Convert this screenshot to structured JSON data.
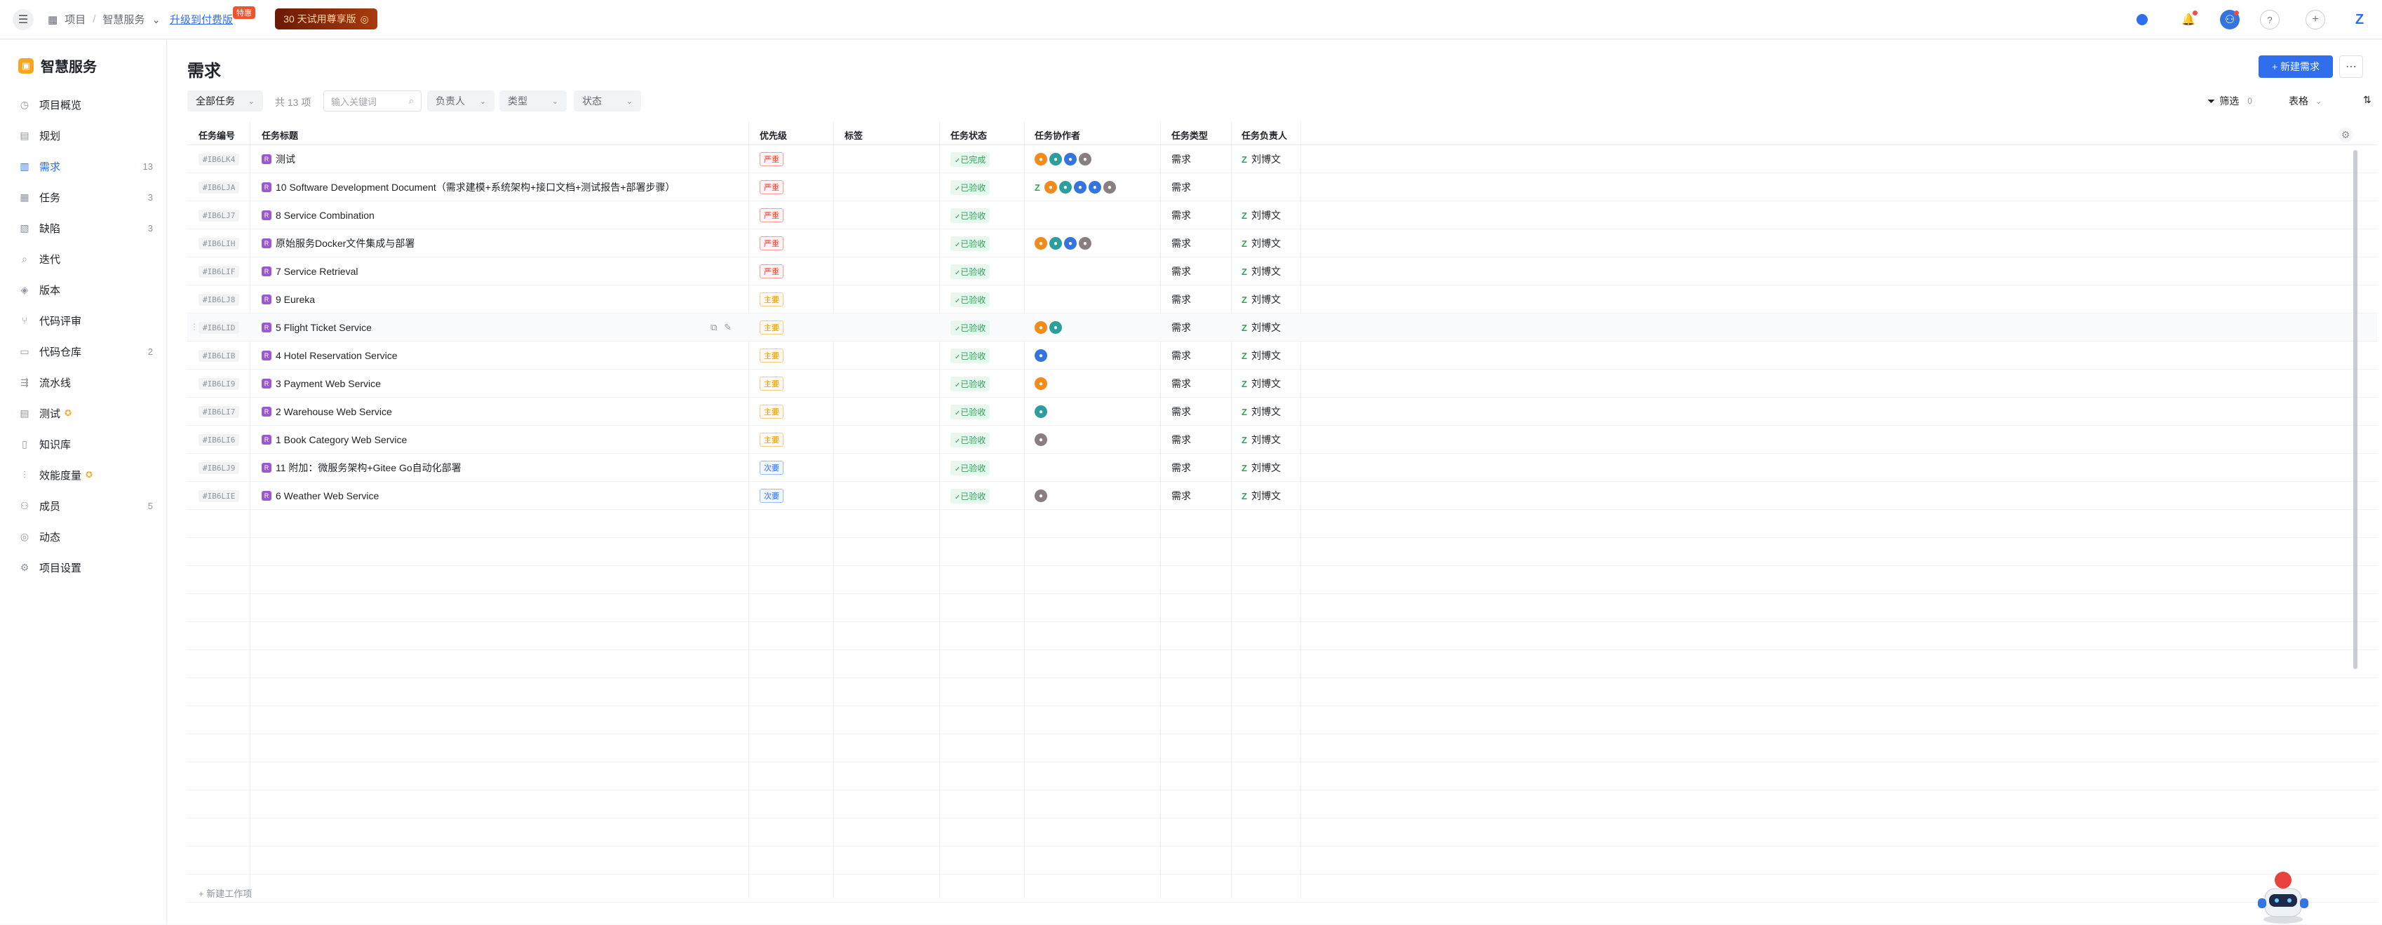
{
  "topbar": {
    "breadcrumb": [
      "项目",
      "智慧服务"
    ],
    "upgrade_label": "升级到付费版",
    "upgrade_badge": "特惠",
    "trial_label": "30 天试用尊享版",
    "icons": [
      "menu-icon",
      "dashboard-icon",
      "bell-icon",
      "avatar",
      "help-icon",
      "plus-icon",
      "logo-icon"
    ]
  },
  "sidebar": {
    "project_name": "智慧服务",
    "items": [
      {
        "label": "项目概览",
        "icon": "overview-icon",
        "count": ""
      },
      {
        "label": "规划",
        "icon": "plan-icon",
        "count": ""
      },
      {
        "label": "需求",
        "icon": "requirement-icon",
        "count": "13",
        "active": true
      },
      {
        "label": "任务",
        "icon": "task-icon",
        "count": "3"
      },
      {
        "label": "缺陷",
        "icon": "bug-icon",
        "count": "3"
      },
      {
        "label": "迭代",
        "icon": "iteration-icon",
        "count": ""
      },
      {
        "label": "版本",
        "icon": "version-icon",
        "count": ""
      },
      {
        "label": "代码评审",
        "icon": "code-review-icon",
        "count": ""
      },
      {
        "label": "代码仓库",
        "icon": "repo-icon",
        "count": "2"
      },
      {
        "label": "流水线",
        "icon": "pipeline-icon",
        "count": ""
      },
      {
        "label": "测试",
        "icon": "test-icon",
        "count": "",
        "star": true
      },
      {
        "label": "知识库",
        "icon": "wiki-icon",
        "count": ""
      },
      {
        "label": "效能度量",
        "icon": "metrics-icon",
        "count": "",
        "star": true
      },
      {
        "label": "成员",
        "icon": "members-icon",
        "count": "5"
      },
      {
        "label": "动态",
        "icon": "activity-icon",
        "count": ""
      },
      {
        "label": "项目设置",
        "icon": "settings-icon",
        "count": ""
      }
    ]
  },
  "main": {
    "title": "需求",
    "new_button": "+ 新建需求",
    "filters": {
      "all_tasks": "全部任务",
      "total": "共 13 项",
      "search_placeholder": "输入关键词",
      "assignee": "负责人",
      "type": "类型",
      "status": "状态",
      "filter_label": "筛选",
      "filter_count": "0",
      "view_label": "表格"
    },
    "columns": [
      "任务编号",
      "任务标题",
      "优先级",
      "标签",
      "任务状态",
      "任务协作者",
      "任务类型",
      "任务负责人"
    ],
    "rows": [
      {
        "id": "#IB6LK4",
        "title": "测试",
        "priority": "严重",
        "pcolor": "red",
        "status": "已完成",
        "collab": [
          "o",
          "t",
          "b",
          "g"
        ],
        "type": "需求",
        "owner": "刘博文"
      },
      {
        "id": "#IB6LJA",
        "title": "10 Software Development Document（需求建模+系统架构+接口文档+测试报告+部署步骤）",
        "priority": "严重",
        "pcolor": "red",
        "status": "已验收",
        "collab": [
          "z",
          "o",
          "t",
          "b",
          "b",
          "g"
        ],
        "type": "需求",
        "owner": ""
      },
      {
        "id": "#IB6LJ7",
        "title": "8 Service Combination",
        "priority": "严重",
        "pcolor": "red",
        "status": "已验收",
        "collab": [],
        "type": "需求",
        "owner": "刘博文"
      },
      {
        "id": "#IB6LIH",
        "title": "原始服务Docker文件集成与部署",
        "priority": "严重",
        "pcolor": "red",
        "status": "已验收",
        "collab": [
          "o",
          "t",
          "b",
          "g"
        ],
        "type": "需求",
        "owner": "刘博文"
      },
      {
        "id": "#IB6LIF",
        "title": "7 Service Retrieval",
        "priority": "严重",
        "pcolor": "red",
        "status": "已验收",
        "collab": [],
        "type": "需求",
        "owner": "刘博文"
      },
      {
        "id": "#IB6LJ8",
        "title": "9 Eureka",
        "priority": "主要",
        "pcolor": "yellow",
        "status": "已验收",
        "collab": [],
        "type": "需求",
        "owner": "刘博文"
      },
      {
        "id": "#IB6LID",
        "title": "5 Flight Ticket Service",
        "priority": "主要",
        "pcolor": "yellow",
        "status": "已验收",
        "collab": [
          "o",
          "t"
        ],
        "type": "需求",
        "owner": "刘博文"
      },
      {
        "id": "#IB6LIB",
        "title": "4 Hotel Reservation Service",
        "priority": "主要",
        "pcolor": "yellow",
        "status": "已验收",
        "collab": [
          "b"
        ],
        "type": "需求",
        "owner": "刘博文"
      },
      {
        "id": "#IB6LI9",
        "title": "3 Payment Web Service",
        "priority": "主要",
        "pcolor": "yellow",
        "status": "已验收",
        "collab": [
          "o"
        ],
        "type": "需求",
        "owner": "刘博文"
      },
      {
        "id": "#IB6LI7",
        "title": "2 Warehouse Web Service",
        "priority": "主要",
        "pcolor": "yellow",
        "status": "已验收",
        "collab": [
          "t"
        ],
        "type": "需求",
        "owner": "刘博文"
      },
      {
        "id": "#IB6LI6",
        "title": "1 Book Category Web Service",
        "priority": "主要",
        "pcolor": "yellow",
        "status": "已验收",
        "collab": [
          "g"
        ],
        "type": "需求",
        "owner": "刘博文"
      },
      {
        "id": "#IB6LJ9",
        "title": "11 附加：微服务架构+Gitee Go自动化部署",
        "priority": "次要",
        "pcolor": "blue",
        "status": "已验收",
        "collab": [],
        "type": "需求",
        "owner": "刘博文"
      },
      {
        "id": "#IB6LIE",
        "title": "6 Weather Web Service",
        "priority": "次要",
        "pcolor": "blue",
        "status": "已验收",
        "collab": [
          "g"
        ],
        "type": "需求",
        "owner": "刘博文"
      }
    ],
    "add_item": "+ 新建工作项"
  }
}
